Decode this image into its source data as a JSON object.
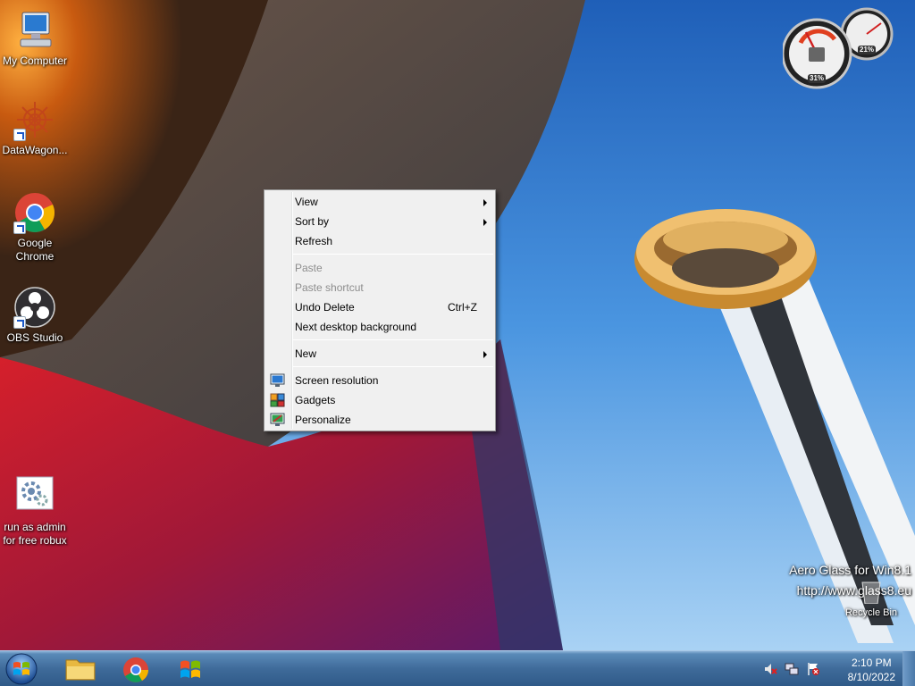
{
  "desktop": {
    "icons": [
      {
        "label": "My Computer",
        "icon": "computer-icon"
      },
      {
        "label": "DataWagon...",
        "icon": "datawagon-icon"
      },
      {
        "label": "Google\nChrome",
        "icon": "chrome-icon"
      },
      {
        "label": "OBS Studio",
        "icon": "obs-icon"
      },
      {
        "label": "run as admin\nfor free robux",
        "icon": "settings-gear-icon"
      }
    ],
    "recycle_bin": "Recycle Bin",
    "watermark_line1": "Aero Glass for Win8.1",
    "watermark_line2": "http://www.glass8.eu"
  },
  "gadgets": {
    "cpu_meter": {
      "cpu_percent": "31%",
      "memory_percent": "21%"
    }
  },
  "context_menu": {
    "items": [
      {
        "label": "View",
        "submenu": true
      },
      {
        "label": "Sort by",
        "submenu": true
      },
      {
        "label": "Refresh"
      },
      {
        "label": "Paste",
        "disabled": true
      },
      {
        "label": "Paste shortcut",
        "disabled": true
      },
      {
        "label": "Undo Delete",
        "shortcut": "Ctrl+Z"
      },
      {
        "label": "Next desktop background"
      },
      {
        "label": "New",
        "submenu": true
      },
      {
        "label": "Screen resolution",
        "icon": "monitor-icon"
      },
      {
        "label": "Gadgets",
        "icon": "gadgets-icon"
      },
      {
        "label": "Personalize",
        "icon": "personalize-icon"
      }
    ]
  },
  "taskbar": {
    "pinned": [
      "file-explorer-icon",
      "chrome-icon",
      "windows-flag-icon"
    ],
    "clock": {
      "time": "2:10 PM",
      "date": "8/10/2022"
    }
  },
  "colors": {
    "sky": "#3f86d6",
    "taskbar": "#3f6b9a",
    "menu_bg": "#f0f0f0"
  }
}
